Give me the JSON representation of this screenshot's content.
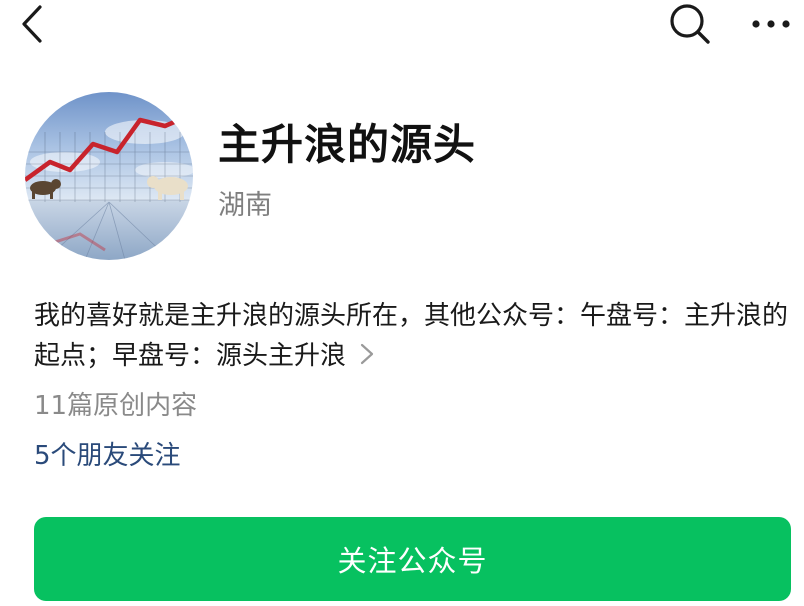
{
  "header": {
    "back_icon": "chevron-left-icon",
    "search_icon": "search-icon",
    "more_icon": "more-dots-icon"
  },
  "profile": {
    "avatar": "bull-bear-stock-chart-image",
    "name": "主升浪的源头",
    "location": "湖南",
    "description": "我的喜好就是主升浪的源头所在，其他公众号：午盘号：主升浪的起点；早盘号：源头主升浪",
    "description_more_icon": "chevron-right-icon",
    "article_count": "11篇原创内容",
    "friends_following": "5个朋友关注"
  },
  "actions": {
    "follow_label": "关注公众号",
    "follow_color": "#07c160"
  }
}
